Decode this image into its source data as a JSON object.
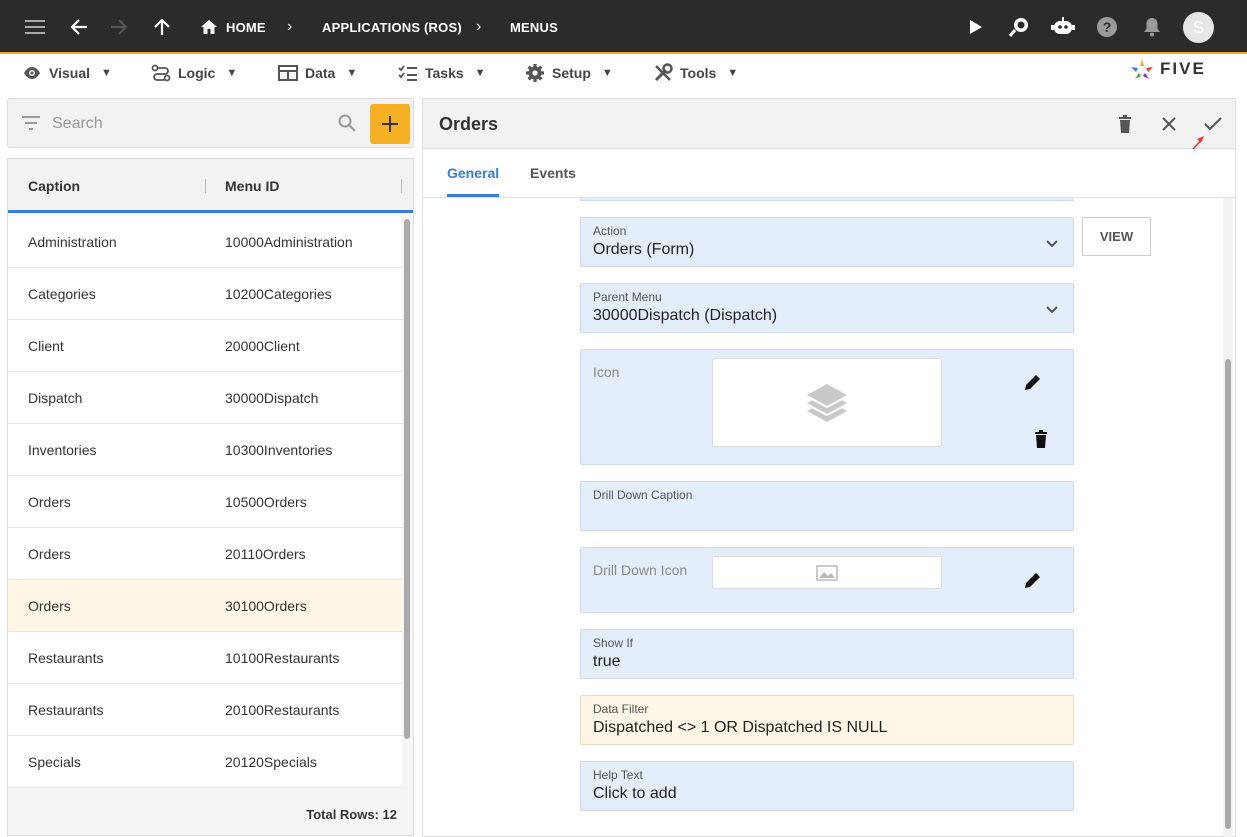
{
  "topbar": {
    "breadcrumb": [
      "HOME",
      "APPLICATIONS (ROS)",
      "MENUS"
    ],
    "avatar_letter": "S"
  },
  "menubar": {
    "items": [
      "Visual",
      "Logic",
      "Data",
      "Tasks",
      "Setup",
      "Tools"
    ],
    "caret": "▼",
    "logo_text": "FIVE"
  },
  "search": {
    "placeholder": "Search"
  },
  "list": {
    "columns": [
      "Caption",
      "Menu ID"
    ],
    "rows": [
      {
        "caption": "Administration",
        "menu_id": "10000Administration"
      },
      {
        "caption": "Categories",
        "menu_id": "10200Categories"
      },
      {
        "caption": "Client",
        "menu_id": "20000Client"
      },
      {
        "caption": "Dispatch",
        "menu_id": "30000Dispatch"
      },
      {
        "caption": "Inventories",
        "menu_id": "10300Inventories"
      },
      {
        "caption": "Orders",
        "menu_id": "10500Orders"
      },
      {
        "caption": "Orders",
        "menu_id": "20110Orders"
      },
      {
        "caption": "Orders",
        "menu_id": "30100Orders"
      },
      {
        "caption": "Restaurants",
        "menu_id": "10100Restaurants"
      },
      {
        "caption": "Restaurants",
        "menu_id": "20100Restaurants"
      },
      {
        "caption": "Specials",
        "menu_id": "20120Specials"
      }
    ],
    "total": "Total Rows: 12"
  },
  "form": {
    "title": "Orders",
    "tabs": [
      "General",
      "Events"
    ],
    "action": {
      "label": "Action",
      "value": "Orders (Form)"
    },
    "view_label": "VIEW",
    "parent_menu": {
      "label": "Parent Menu",
      "value": "30000Dispatch (Dispatch)"
    },
    "icon": {
      "label": "Icon"
    },
    "drill_down_caption": {
      "label": "Drill Down Caption",
      "value": ""
    },
    "drill_down_icon": {
      "label": "Drill Down Icon"
    },
    "show_if": {
      "label": "Show If",
      "value": "true"
    },
    "data_filter": {
      "label": "Data Filter",
      "value": "Dispatched <> 1 OR Dispatched IS NULL"
    },
    "help_text": {
      "label": "Help Text",
      "value": "Click to add"
    }
  },
  "colors": {
    "topbar": "#2b2b2b",
    "accent": "#f5b123",
    "tab_active": "#3a7bd5",
    "field_bg": "#e3eefa",
    "field_warn_bg": "#fdf6e6",
    "selected_row": "#fff6e5"
  }
}
